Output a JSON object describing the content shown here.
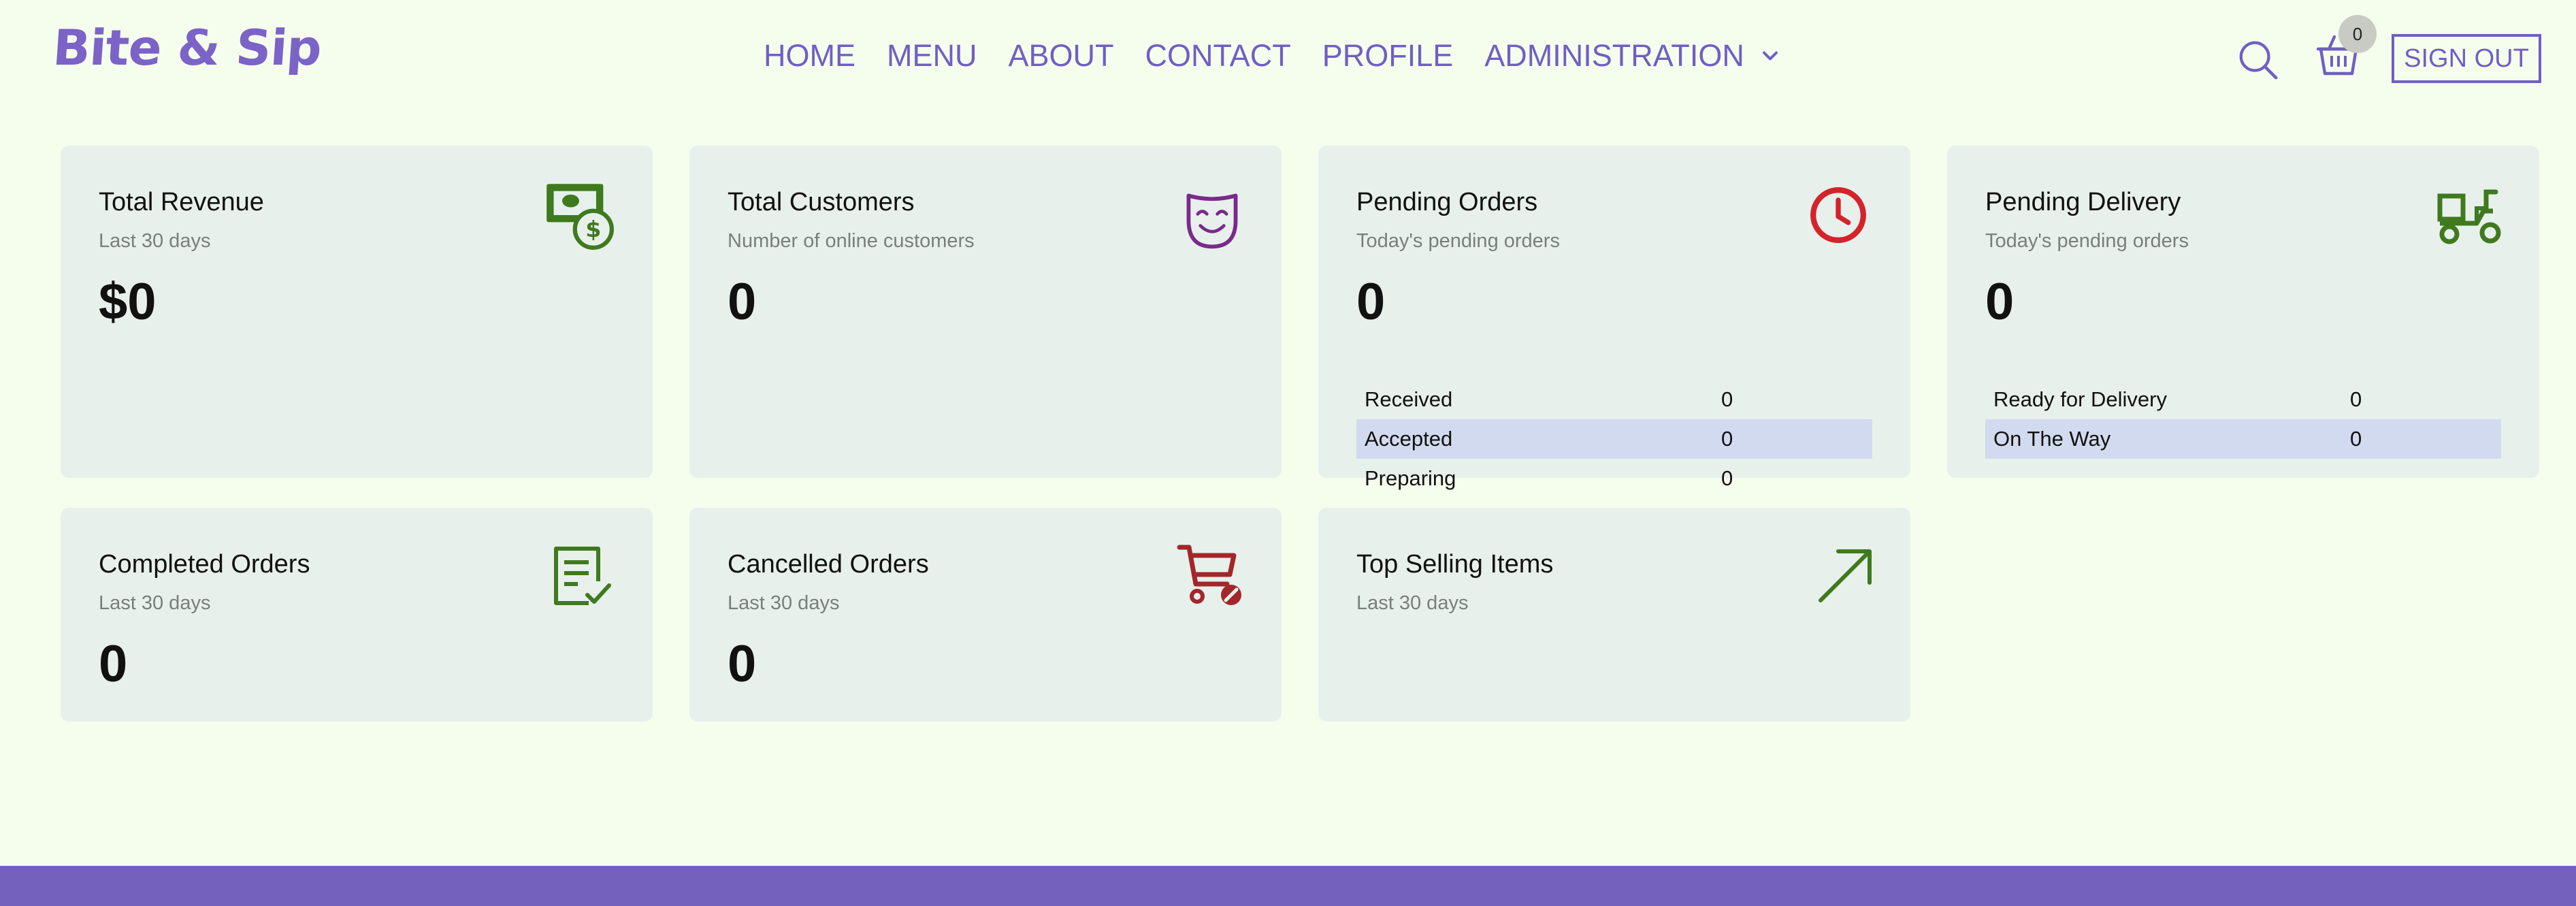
{
  "brand": {
    "name": "Bite & Sip",
    "accent": "#7b63c8"
  },
  "nav": {
    "items": [
      "HOME",
      "MENU",
      "ABOUT",
      "CONTACT",
      "PROFILE",
      "ADMINISTRATION"
    ],
    "admin_icon": "chevron-down-icon"
  },
  "header": {
    "search_icon": "search-icon",
    "cart_icon": "basket-icon",
    "cart_count": "0",
    "signout_label": "SIGN OUT"
  },
  "cards": {
    "revenue": {
      "title": "Total Revenue",
      "subtitle": "Last 30 days",
      "value": "$0",
      "icon": "money-icon",
      "icon_color": "#3f7a1e"
    },
    "customers": {
      "title": "Total Customers",
      "subtitle": "Number of online customers",
      "value": "0",
      "icon": "mask-icon",
      "icon_color": "#7a2a8a"
    },
    "pending_orders": {
      "title": "Pending Orders",
      "subtitle": "Today's pending orders",
      "value": "0",
      "icon": "clock-icon",
      "icon_color": "#d4232b",
      "rows": [
        {
          "label": "Received",
          "value": "0"
        },
        {
          "label": "Accepted",
          "value": "0"
        },
        {
          "label": "Preparing",
          "value": "0"
        }
      ]
    },
    "pending_delivery": {
      "title": "Pending Delivery",
      "subtitle": "Today's pending orders",
      "value": "0",
      "icon": "delivery-scooter-icon",
      "icon_color": "#3f7a1e",
      "rows": [
        {
          "label": "Ready for Delivery",
          "value": "0"
        },
        {
          "label": "On The Way",
          "value": "0"
        }
      ]
    },
    "completed": {
      "title": "Completed Orders",
      "subtitle": "Last 30 days",
      "value": "0",
      "icon": "checklist-icon",
      "icon_color": "#3f7a1e"
    },
    "cancelled": {
      "title": "Cancelled Orders",
      "subtitle": "Last 30 days",
      "value": "0",
      "icon": "cart-cancel-icon",
      "icon_color": "#a3262b"
    },
    "top_selling": {
      "title": "Top Selling Items",
      "subtitle": "Last 30 days",
      "icon": "arrow-up-right-icon",
      "icon_color": "#3f7a1e"
    }
  },
  "colors": {
    "page_bg": "#f5fdec",
    "card_bg": "#e8f0ec",
    "row_highlight": "#d2daef",
    "nav_text": "#6f5fc4",
    "footer": "#7461bd"
  }
}
